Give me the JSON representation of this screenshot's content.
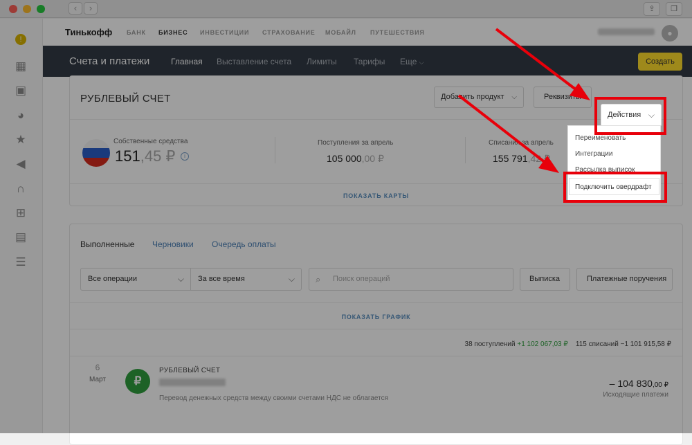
{
  "browser": {
    "colors": {
      "close": "#fe5f57",
      "minimize": "#febc2e",
      "zoom": "#28c840"
    },
    "back_icon": "chevron-left-icon",
    "forward_icon": "chevron-right-icon",
    "share_icon": "share-icon",
    "tabs_icon": "tabs-icon"
  },
  "sidebar": {
    "items": [
      "notification-icon",
      "calculator-icon",
      "calendar-icon",
      "chart-pie-icon",
      "star-icon",
      "megaphone-icon",
      "headset-icon",
      "structure-icon",
      "table-icon",
      "add-list-icon"
    ]
  },
  "topbar": {
    "logo": "Тинькофф",
    "nav": [
      "БАНК",
      "БИЗНЕС",
      "ИНВЕСТИЦИИ",
      "СТРАХОВАНИЕ",
      "МОБАЙЛ",
      "ПУТЕШЕСТВИЯ"
    ],
    "active": "БИЗНЕС"
  },
  "header": {
    "title": "Счета и платежи",
    "nav": [
      "Главная",
      "Выставление счета",
      "Лимиты",
      "Тарифы",
      "Еще"
    ],
    "create": "Создать"
  },
  "account": {
    "title": "РУБЛЕВЫЙ СЧЕТ",
    "add_product": "Добавить продукт",
    "requisites": "Реквизиты",
    "actions": "Действия",
    "own_funds_label": "Собственные средства",
    "own_funds_main": "151",
    "own_funds_kop": ",45 ₽",
    "income_label": "Поступления за апрель",
    "income_main": "105 000",
    "income_kop": ",00 ₽",
    "outgo_label": "Списания за апрель",
    "outgo_main": "155 791",
    "outgo_kop": ",42 ₽",
    "show_cards": "ПОКАЗАТЬ КАРТЫ"
  },
  "dropdown": {
    "items": [
      "Переименовать",
      "Интеграции",
      "Рассылка выписок",
      "Подключить овердрафт"
    ]
  },
  "operations": {
    "tabs": [
      "Выполненные",
      "Черновики",
      "Очередь оплаты"
    ],
    "filter_ops": "Все операции",
    "filter_time": "За все время",
    "search_placeholder": "Поиск операций",
    "statement": "Выписка",
    "payment_orders": "Платежные поручения",
    "show_graph": "ПОКАЗАТЬ ГРАФИК",
    "summary_in_count": "38 поступлений",
    "summary_in_amount": "+1 102 067,03 ₽",
    "summary_out": "115 списаний −1 101 915,58 ₽"
  },
  "transaction": {
    "day": "6",
    "month": "Март",
    "icon": "₽",
    "title": "РУБЛЕВЫЙ СЧЕТ",
    "description": "Перевод денежных средств между своими счетами НДС не облагается",
    "amount_main": "– 104 830",
    "amount_kop": ",00 ₽",
    "type": "Исходящие платежи"
  }
}
